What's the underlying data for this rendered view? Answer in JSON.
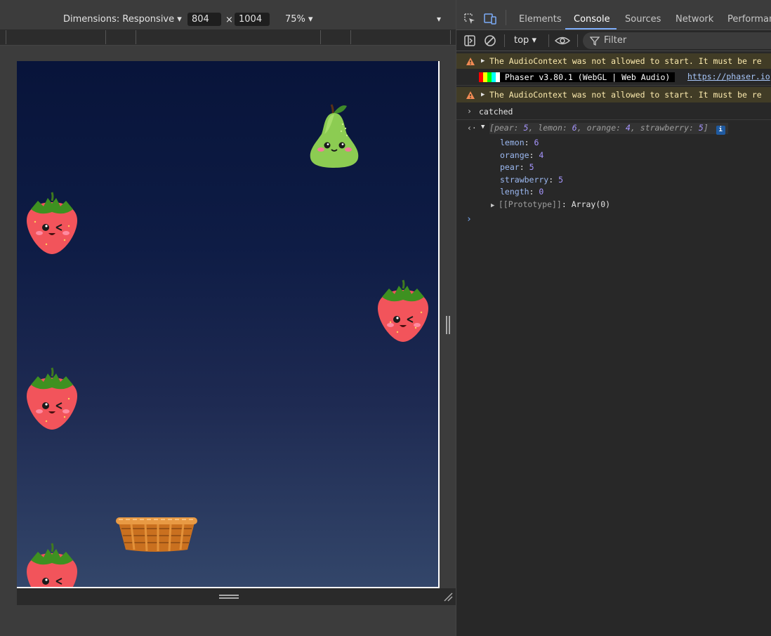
{
  "device_toolbar": {
    "dimensions_label": "Dimensions: Responsive",
    "width": "804",
    "times": "×",
    "height": "1004",
    "zoom": "75%"
  },
  "game": {
    "background_top": "#08143a",
    "background_bottom": "#33466a",
    "sprites": [
      "pear",
      "strawberry",
      "strawberry",
      "strawberry",
      "strawberry",
      "basket"
    ]
  },
  "devtools": {
    "tabs": [
      "Elements",
      "Console",
      "Sources",
      "Network",
      "Performance"
    ],
    "active_tab": "Console",
    "context": "top",
    "filter_placeholder": "Filter"
  },
  "console": {
    "warning1": "The AudioContext was not allowed to start. It must be re",
    "phaser_banner": " Phaser v3.80.1 (WebGL | Web Audio) ",
    "phaser_link": "https://phaser.io",
    "warning2": "The AudioContext was not allowed to start. It must be re",
    "log_text": "catched",
    "array_preview": {
      "open": "[",
      "items": [
        {
          "key": "pear",
          "value": "5"
        },
        {
          "key": "lemon",
          "value": "6"
        },
        {
          "key": "orange",
          "value": "4"
        },
        {
          "key": "strawberry",
          "value": "5"
        }
      ],
      "close": "]"
    },
    "expanded": [
      {
        "key": "lemon",
        "value": "6"
      },
      {
        "key": "orange",
        "value": "4"
      },
      {
        "key": "pear",
        "value": "5"
      },
      {
        "key": "strawberry",
        "value": "5"
      },
      {
        "key": "length",
        "value": "0"
      }
    ],
    "prototype_key": "[[Prototype]]",
    "prototype_value": "Array(0)"
  }
}
